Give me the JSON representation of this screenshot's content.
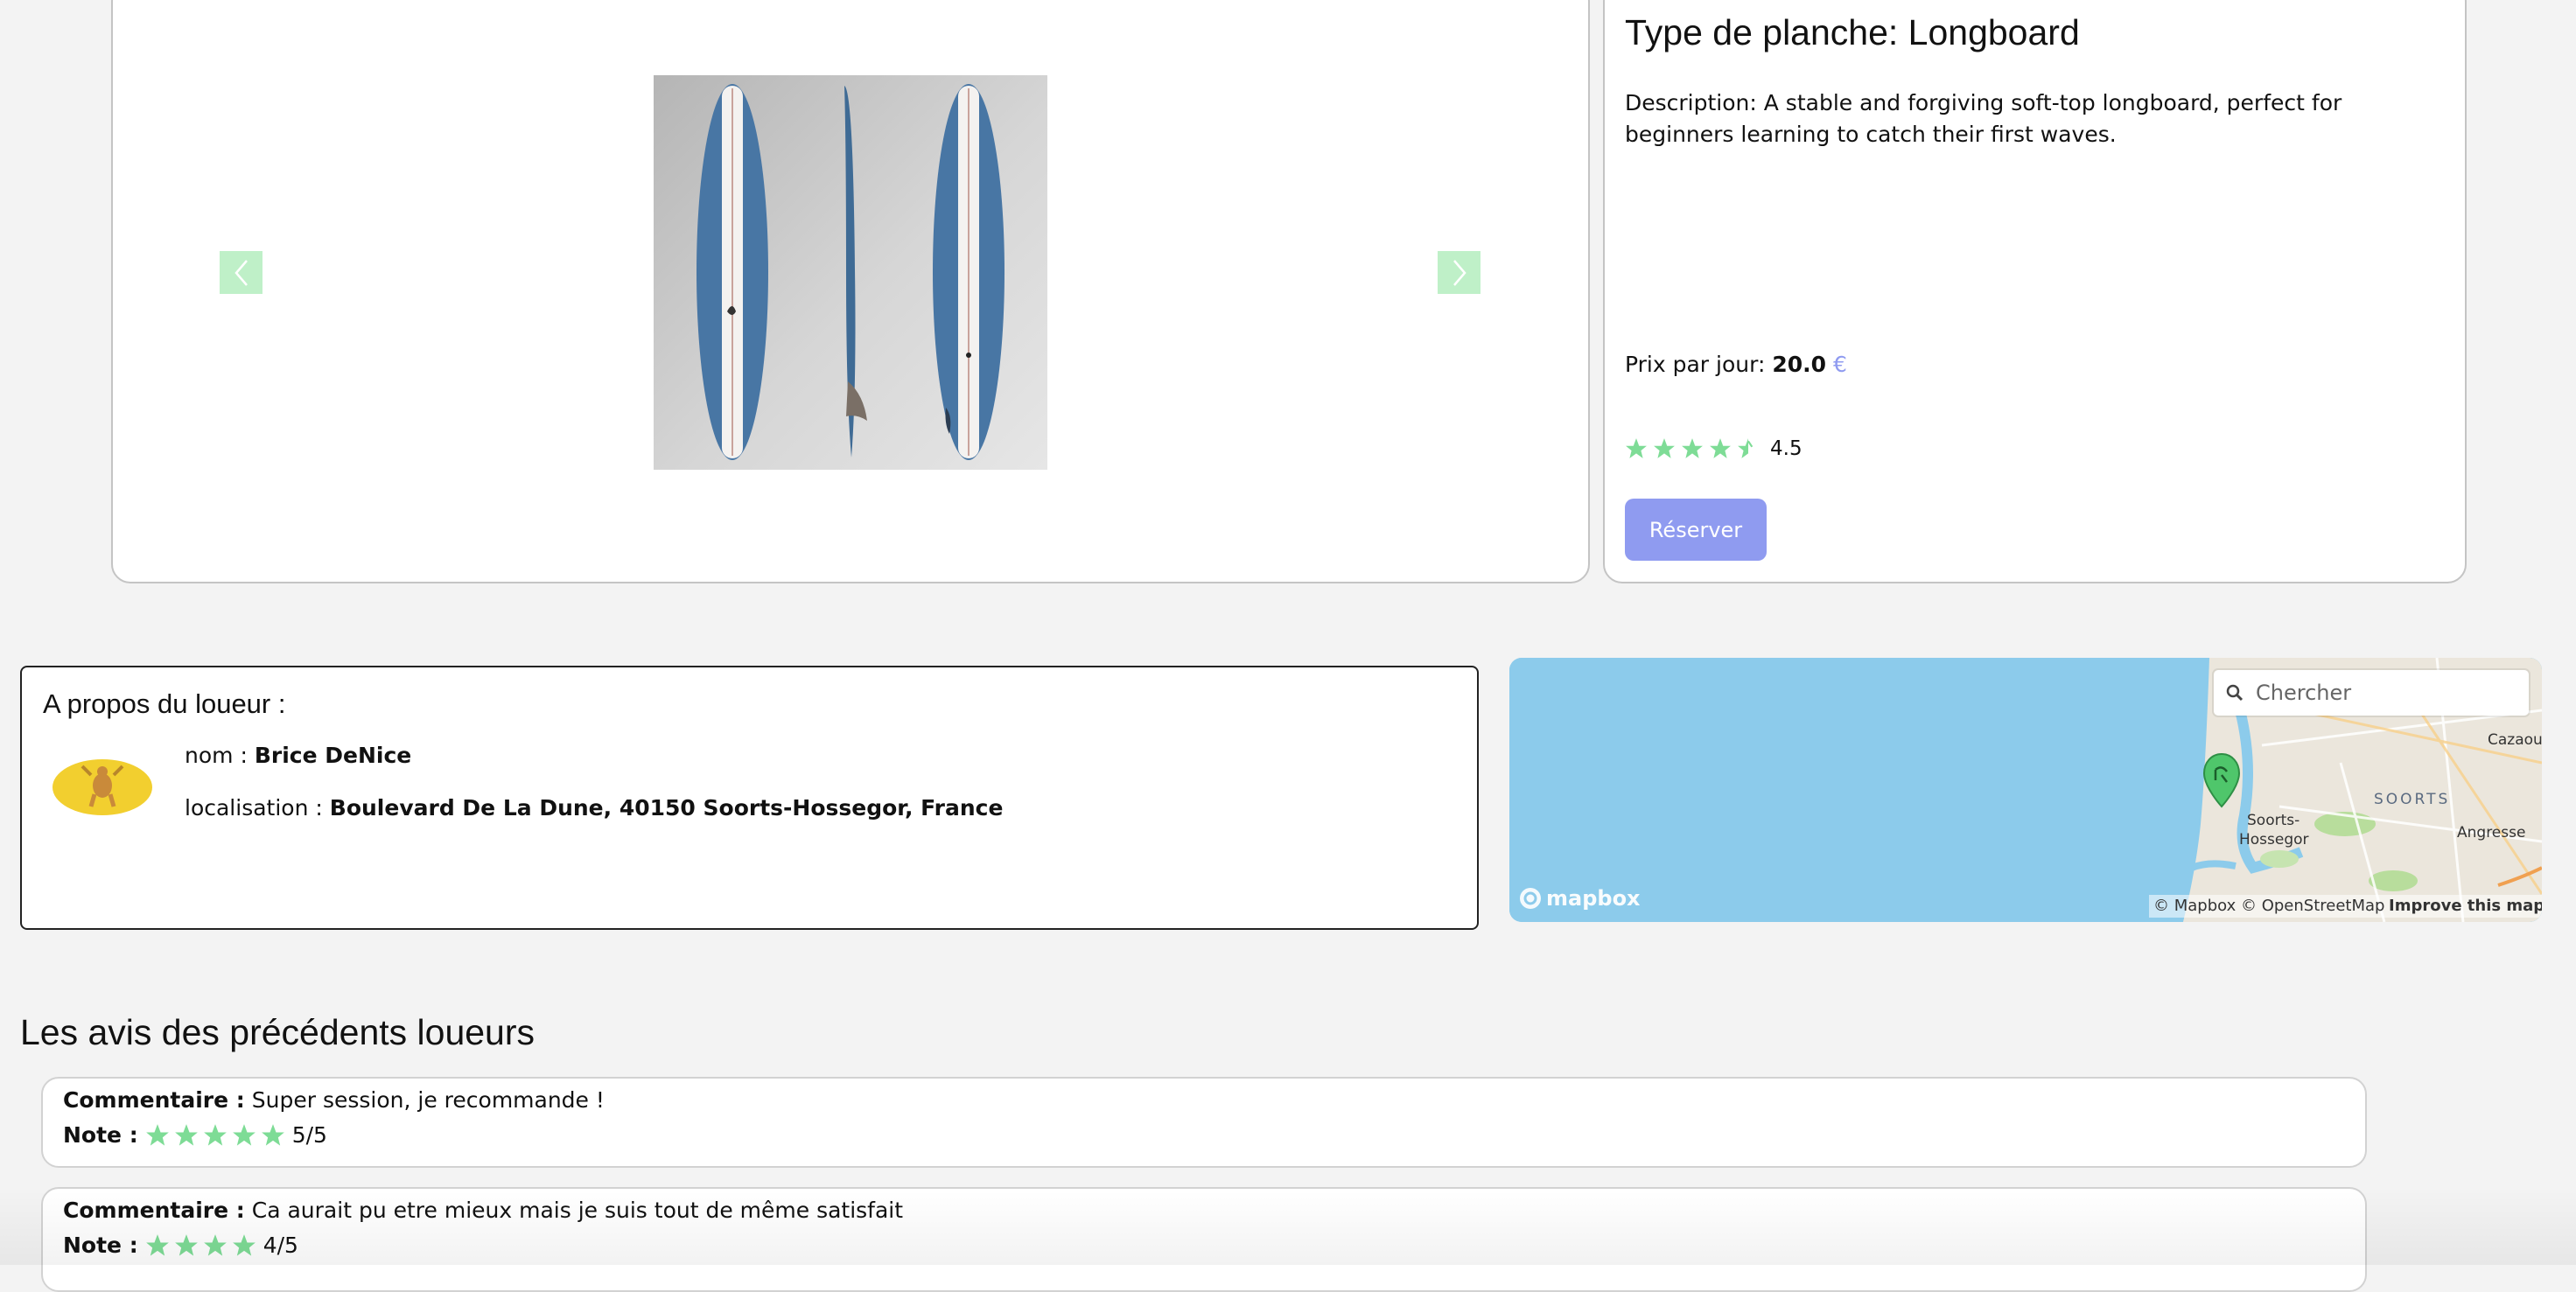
{
  "product": {
    "title": "Type de planche: Longboard",
    "description": "Description: A stable and forgiving soft-top longboard, perfect for beginners learning to catch their first waves.",
    "price_label": "Prix par jour:",
    "price_value": "20.0",
    "currency": "€",
    "rating_value": 4.5,
    "rating_text": "4.5",
    "reserve_label": "Réserver",
    "image_icon": "surfboard-image",
    "prev_icon": "chevron-left-icon",
    "next_icon": "chevron-right-icon"
  },
  "owner": {
    "title": "A propos du loueur :",
    "name_label": "nom :",
    "name_value": "Brice DeNice",
    "location_label": "localisation :",
    "location_value": "Boulevard De La Dune, 40150 Soorts-Hossegor, France"
  },
  "map": {
    "search_placeholder": "Chercher",
    "labels": [
      "SOORTS",
      "Soorts-",
      "Hossegor",
      "Angresse",
      "Cazaoun"
    ],
    "logo_text": "mapbox",
    "attribution": "© Mapbox © OpenStreetMap",
    "improve_link": "Improve this map"
  },
  "reviews": {
    "title": "Les avis des précédents loueurs",
    "comment_label": "Commentaire :",
    "note_label": "Note :",
    "items": [
      {
        "comment": "Super session, je recommande !",
        "stars": 5,
        "note_text": "5/5"
      },
      {
        "comment": "Ca aurait pu etre mieux mais je suis tout de même satisfait",
        "stars": 4,
        "note_text": "4/5"
      }
    ]
  },
  "colors": {
    "accent": "#8f9bf0",
    "star": "#7edc96",
    "arrow_bg": "#bff0c8",
    "water": "#8ccbeb",
    "land": "#ebe6dc",
    "avatar_bg": "#f2cf2f"
  }
}
